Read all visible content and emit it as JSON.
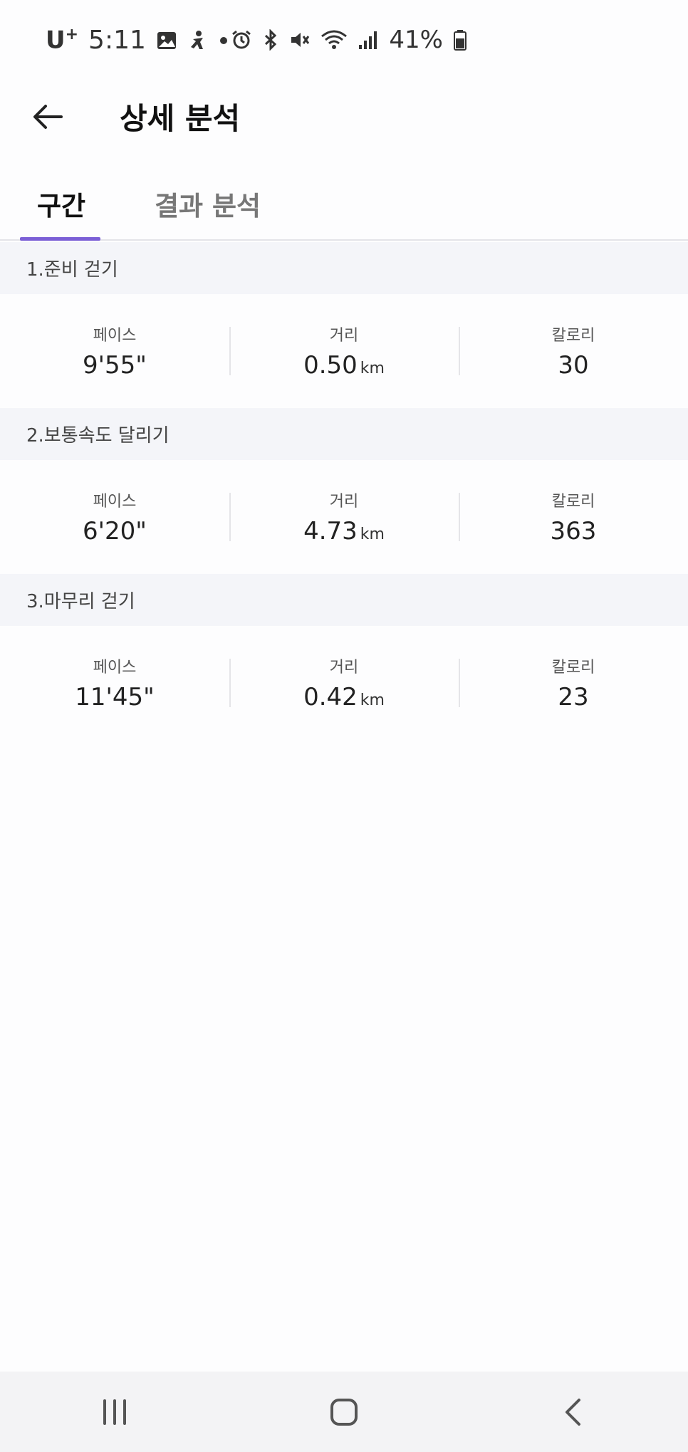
{
  "status_bar": {
    "carrier": "U",
    "carrier_sup": "+",
    "time": "5:11",
    "battery": "41%"
  },
  "app_bar": {
    "title": "상세 분석"
  },
  "tabs": [
    {
      "label": "구간"
    },
    {
      "label": "결과 분석"
    }
  ],
  "sections": [
    {
      "title": "1.준비 걷기",
      "pace_label": "페이스",
      "pace": "9'55\"",
      "distance_label": "거리",
      "distance": "0.50",
      "distance_unit": "km",
      "calorie_label": "칼로리",
      "calorie": "30"
    },
    {
      "title": "2.보통속도 달리기",
      "pace_label": "페이스",
      "pace": "6'20\"",
      "distance_label": "거리",
      "distance": "4.73",
      "distance_unit": "km",
      "calorie_label": "칼로리",
      "calorie": "363"
    },
    {
      "title": "3.마무리 걷기",
      "pace_label": "페이스",
      "pace": "11'45\"",
      "distance_label": "거리",
      "distance": "0.42",
      "distance_unit": "km",
      "calorie_label": "칼로리",
      "calorie": "23"
    }
  ],
  "colors": {
    "accent": "#7b5fd6",
    "section_header_bg": "#f4f5f9"
  }
}
